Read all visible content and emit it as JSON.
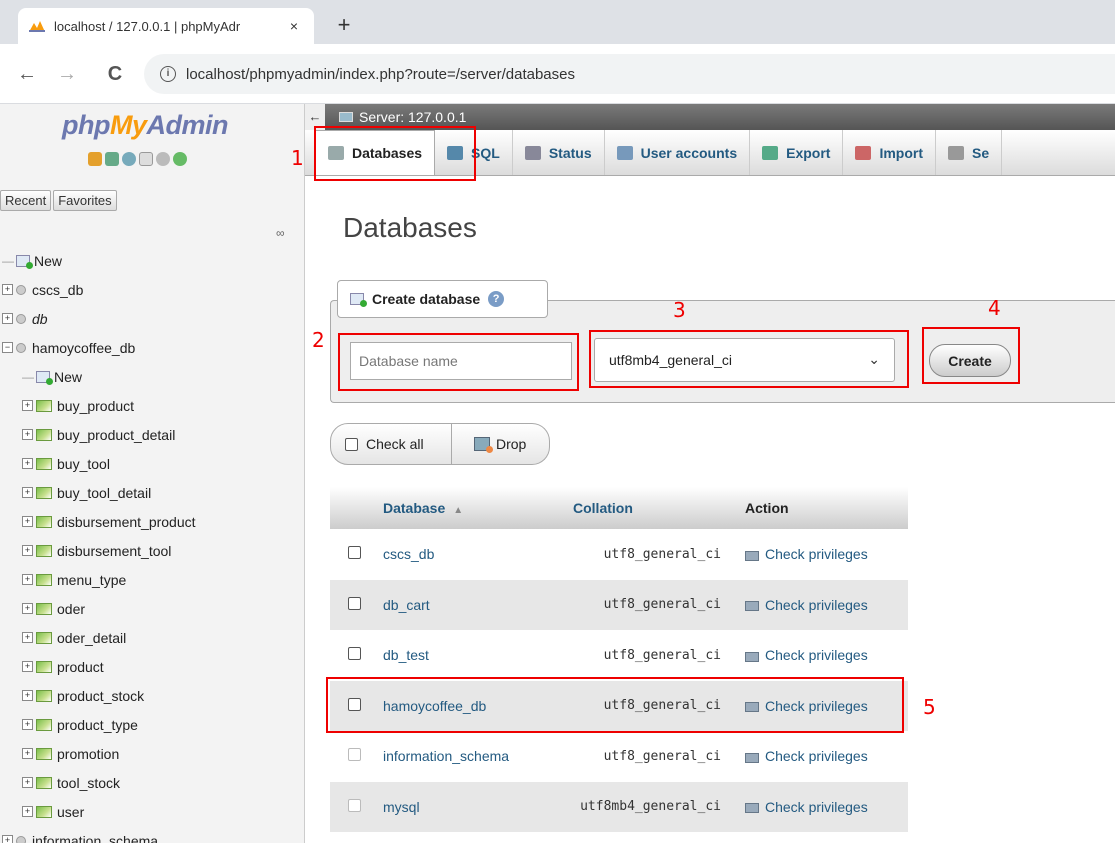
{
  "browser": {
    "tab_title": "localhost / 127.0.0.1 | phpMyAdr",
    "tab_close": "×",
    "new_tab": "+",
    "url": "localhost/phpmyadmin/index.php?route=/server/databases",
    "back": "←",
    "forward": "→",
    "reload": "C",
    "info": "i"
  },
  "sidebar": {
    "logo_php": "php",
    "logo_my": "My",
    "logo_admin": "Admin",
    "recent": "Recent",
    "favorites": "Favorites",
    "tree": [
      {
        "label": "New",
        "type": "new",
        "indent": 0
      },
      {
        "label": "cscs_db",
        "type": "db",
        "indent": 0
      },
      {
        "label": "db",
        "type": "db",
        "indent": 0
      },
      {
        "label": "hamoycoffee_db",
        "type": "db-open",
        "indent": 0
      },
      {
        "label": "New",
        "type": "new",
        "indent": 1
      },
      {
        "label": "buy_product",
        "type": "table",
        "indent": 1
      },
      {
        "label": "buy_product_detail",
        "type": "table",
        "indent": 1
      },
      {
        "label": "buy_tool",
        "type": "table",
        "indent": 1
      },
      {
        "label": "buy_tool_detail",
        "type": "table",
        "indent": 1
      },
      {
        "label": "disbursement_product",
        "type": "table",
        "indent": 1
      },
      {
        "label": "disbursement_tool",
        "type": "table",
        "indent": 1
      },
      {
        "label": "menu_type",
        "type": "table",
        "indent": 1
      },
      {
        "label": "oder",
        "type": "table",
        "indent": 1
      },
      {
        "label": "oder_detail",
        "type": "table",
        "indent": 1
      },
      {
        "label": "product",
        "type": "table",
        "indent": 1
      },
      {
        "label": "product_stock",
        "type": "table",
        "indent": 1
      },
      {
        "label": "product_type",
        "type": "table",
        "indent": 1
      },
      {
        "label": "promotion",
        "type": "table",
        "indent": 1
      },
      {
        "label": "tool_stock",
        "type": "table",
        "indent": 1
      },
      {
        "label": "user",
        "type": "table",
        "indent": 1
      },
      {
        "label": "information_schema",
        "type": "db",
        "indent": 0
      }
    ]
  },
  "server_bar": {
    "label": "Server: 127.0.0.1",
    "collapse": "←"
  },
  "menu": [
    {
      "label": "Databases",
      "active": true,
      "color": "#9aa"
    },
    {
      "label": "SQL",
      "active": false,
      "color": "#58a"
    },
    {
      "label": "Status",
      "active": false,
      "color": "#889"
    },
    {
      "label": "User accounts",
      "active": false,
      "color": "#79b"
    },
    {
      "label": "Export",
      "active": false,
      "color": "#5a8"
    },
    {
      "label": "Import",
      "active": false,
      "color": "#c66"
    },
    {
      "label": "Se",
      "active": false,
      "color": "#999"
    }
  ],
  "main": {
    "title": "Databases",
    "create": {
      "legend": "Create database",
      "help": "?",
      "db_name_placeholder": "Database name",
      "collation": "utf8mb4_general_ci",
      "chevron": "⌄",
      "create_button": "Create"
    },
    "check_all": "Check all",
    "drop": "Drop",
    "table": {
      "headers": {
        "database": "Database",
        "sort": "▲",
        "collation": "Collation",
        "action": "Action"
      },
      "rows": [
        {
          "name": "cscs_db",
          "collation": "utf8_general_ci",
          "action": "Check privileges",
          "system": false
        },
        {
          "name": "db_cart",
          "collation": "utf8_general_ci",
          "action": "Check privileges",
          "system": false
        },
        {
          "name": "db_test",
          "collation": "utf8_general_ci",
          "action": "Check privileges",
          "system": false
        },
        {
          "name": "hamoycoffee_db",
          "collation": "utf8_general_ci",
          "action": "Check privileges",
          "system": false
        },
        {
          "name": "information_schema",
          "collation": "utf8_general_ci",
          "action": "Check privileges",
          "system": true
        },
        {
          "name": "mysql",
          "collation": "utf8mb4_general_ci",
          "action": "Check privileges",
          "system": true
        }
      ]
    }
  },
  "annotations": [
    "1",
    "2",
    "3",
    "4",
    "5"
  ],
  "colors": {
    "accent": "#235a81",
    "annotation": "#ee0000",
    "logo_blue": "#6c78af",
    "logo_orange": "#f89c0e"
  }
}
